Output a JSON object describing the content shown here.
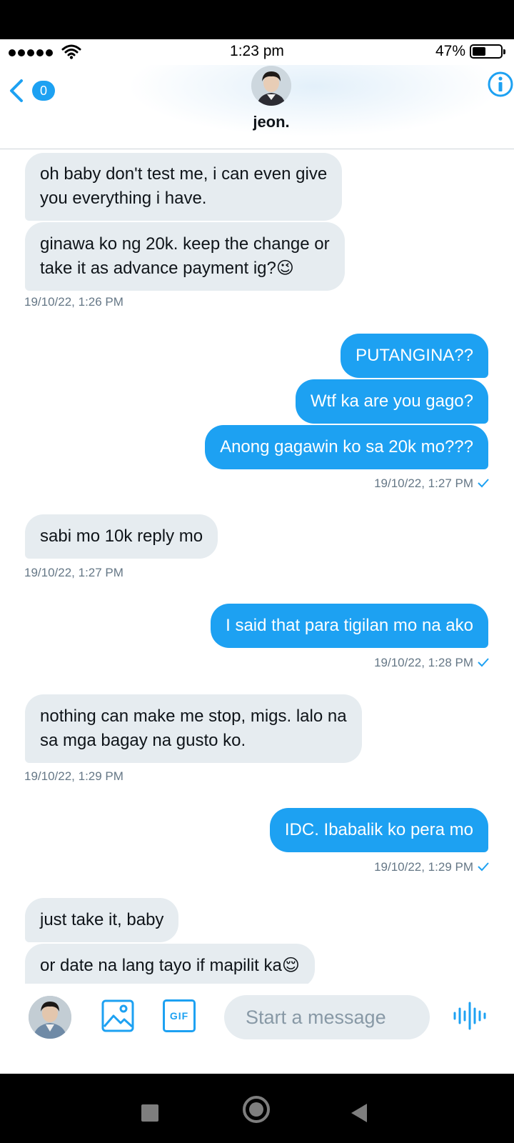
{
  "status_bar": {
    "time": "1:23 pm",
    "battery_percent": "47%",
    "battery_level": 0.47,
    "signal_bars": 5
  },
  "header": {
    "unread_count": "0",
    "contact_name": "jeon."
  },
  "messages": [
    {
      "dir": "in",
      "text": "oh baby don't test me, i can even give\nyou everything i have."
    },
    {
      "dir": "in",
      "text": "ginawa ko ng 20k. keep the change or\ntake it as advance payment ig?😉"
    },
    {
      "dir": "ts-in",
      "text": "19/10/22, 1:26 PM"
    },
    {
      "dir": "out",
      "text": "PUTANGINA??"
    },
    {
      "dir": "out",
      "text": "Wtf ka are you gago?"
    },
    {
      "dir": "out",
      "text": "Anong gagawin ko sa 20k mo???"
    },
    {
      "dir": "ts-out",
      "text": "19/10/22, 1:27 PM"
    },
    {
      "dir": "in",
      "text": "sabi mo 10k reply mo"
    },
    {
      "dir": "ts-in",
      "text": "19/10/22, 1:27 PM"
    },
    {
      "dir": "out",
      "text": "I said that para tigilan mo na ako"
    },
    {
      "dir": "ts-out",
      "text": "19/10/22, 1:28 PM"
    },
    {
      "dir": "in",
      "text": "nothing can make me stop, migs. lalo na\nsa mga bagay na gusto ko."
    },
    {
      "dir": "ts-in",
      "text": "19/10/22, 1:29 PM"
    },
    {
      "dir": "out",
      "text": "IDC. Ibabalik ko pera mo"
    },
    {
      "dir": "ts-out",
      "text": "19/10/22, 1:29 PM"
    },
    {
      "dir": "in",
      "text": "just take it, baby"
    },
    {
      "dir": "in",
      "text": "or date na lang tayo if mapilit ka😌"
    }
  ],
  "composer": {
    "placeholder": "Start a message",
    "gif_label": "GIF"
  },
  "icons": {
    "back": "chevron-left-icon",
    "info": "info-icon",
    "image": "image-icon",
    "gif": "gif-icon",
    "voice": "voice-waveform-icon"
  },
  "colors": {
    "accent": "#1da1f2",
    "incoming_bubble": "#e6ecf0",
    "timestamp": "#657786"
  }
}
